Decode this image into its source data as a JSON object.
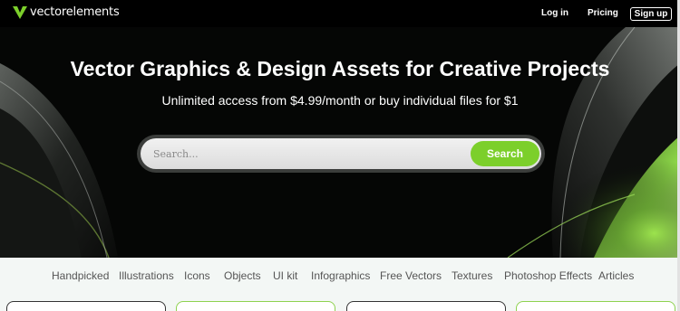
{
  "header": {
    "logo_text": "vectorelements",
    "login_label": "Log in",
    "pricing_label": "Pricing",
    "signup_label": "Sign up"
  },
  "hero": {
    "title": "Vector Graphics & Design Assets for Creative Projects",
    "subtitle": "Unlimited access from $4.99/month or buy individual files for $1",
    "search_placeholder": "Search...",
    "search_button": "Search"
  },
  "categories": [
    "Handpicked",
    "Illustrations",
    "Icons",
    "Objects",
    "UI kit",
    "Infographics",
    "Free Vectors",
    "Textures",
    "Photoshop Effects",
    "Articles"
  ],
  "colors": {
    "accent": "#7ccf2b",
    "topbar": "#000000",
    "hero_bg": "#050605"
  }
}
